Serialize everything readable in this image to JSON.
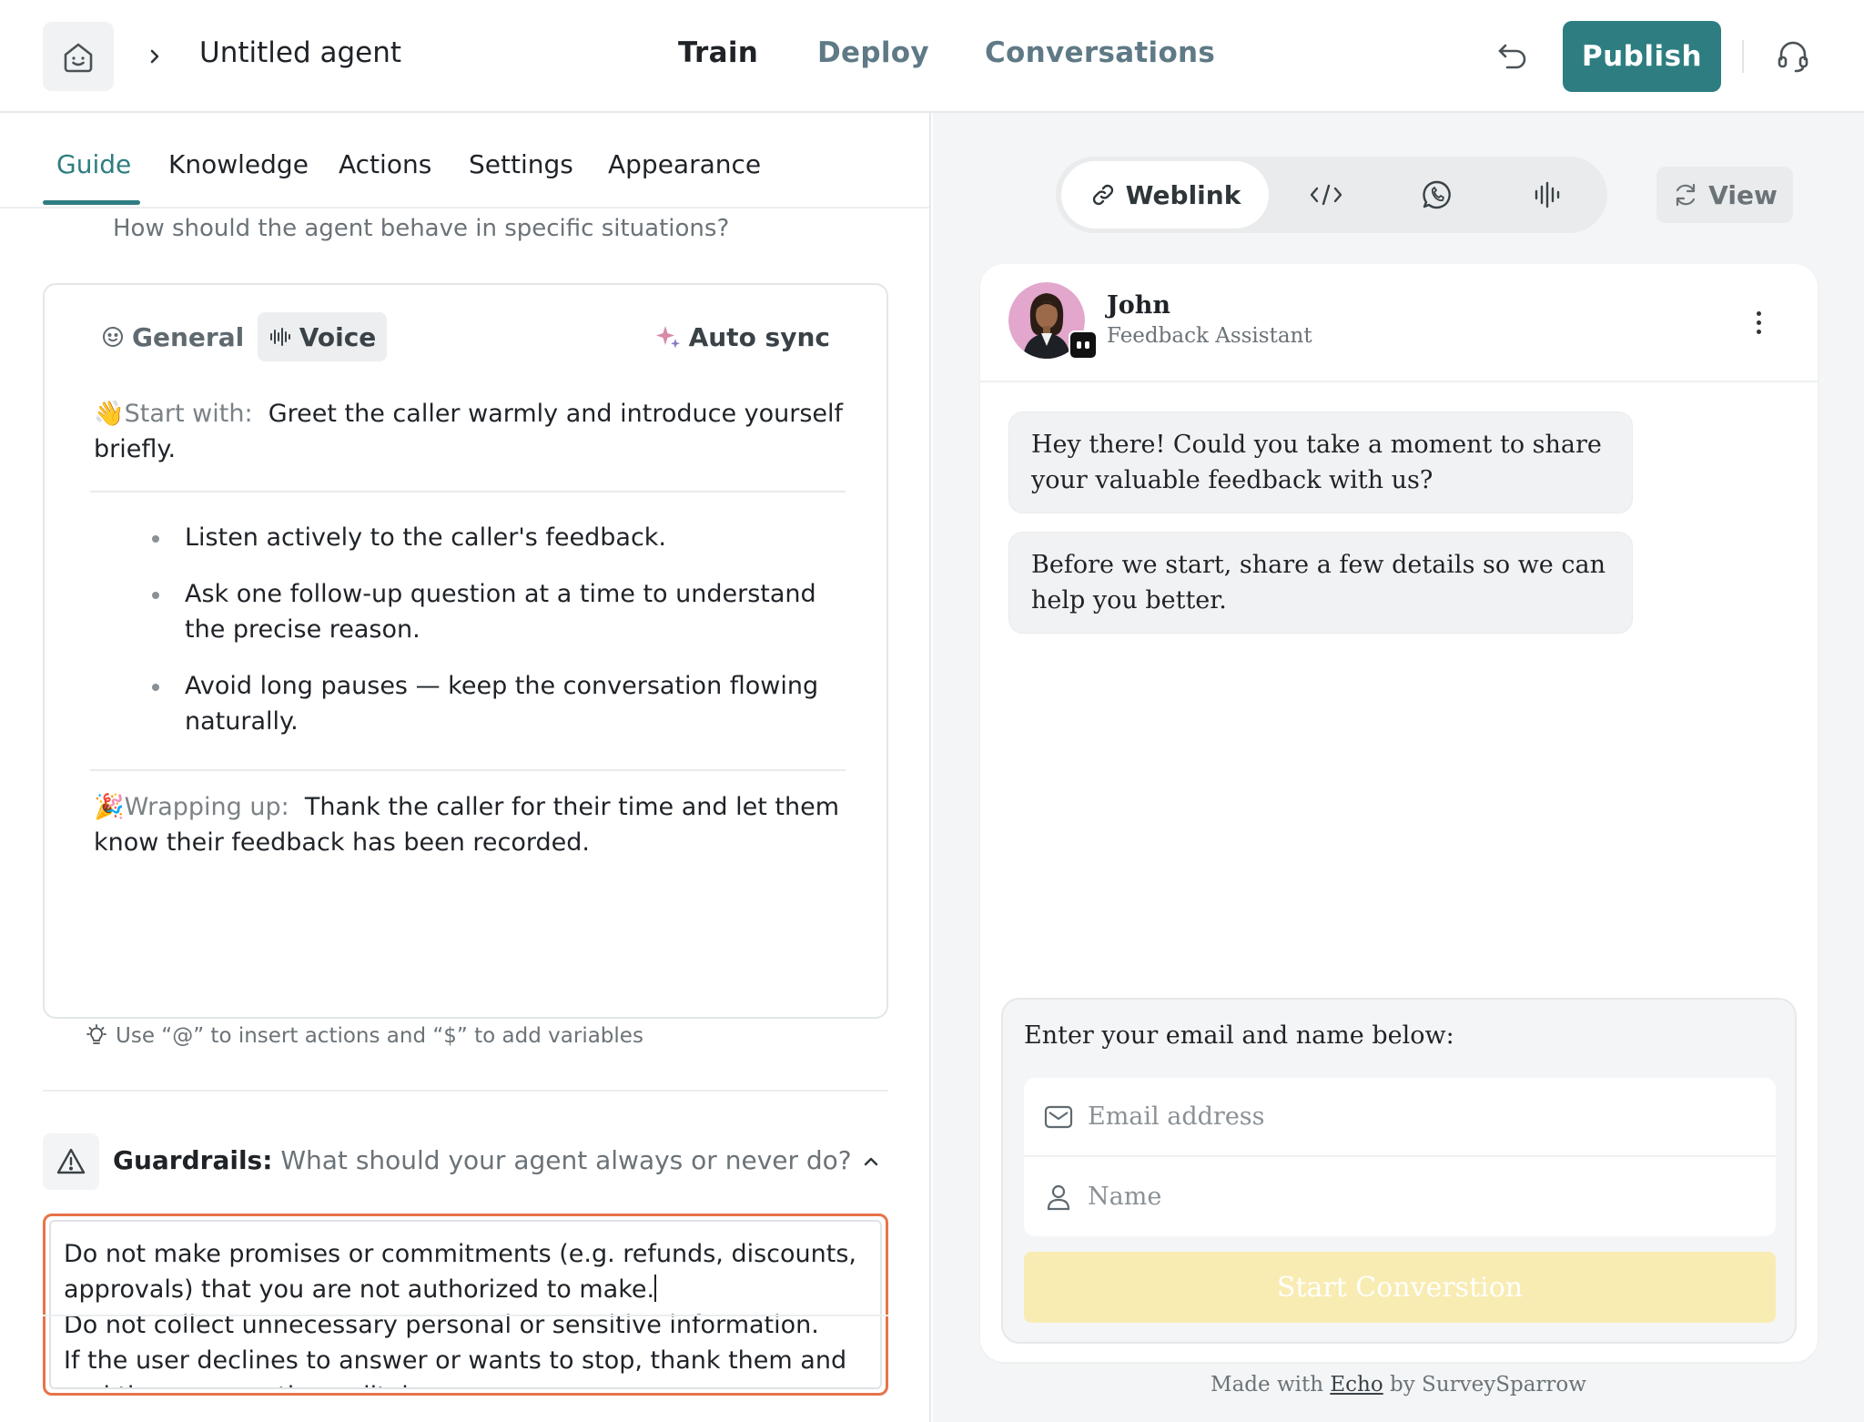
{
  "header": {
    "agent_name": "Untitled agent",
    "nav": [
      "Train",
      "Deploy",
      "Conversations"
    ],
    "active_nav": "Train",
    "publish_label": "Publish",
    "accent": "#2e7d81"
  },
  "left": {
    "tabs": [
      "Guide",
      "Knowledge",
      "Actions",
      "Settings",
      "Appearance"
    ],
    "active_tab": "Guide",
    "situations_hint": "How should the agent behave in specific situations?",
    "chips": {
      "general": "General",
      "voice": "Voice",
      "auto_sync": "Auto sync"
    },
    "start_lead": "Start with:",
    "start_text": "Greet the caller warmly and introduce yourself briefly.",
    "bullets": [
      "Listen actively to the caller's feedback.",
      "Ask one follow-up question at a time to understand the precise reason.",
      "Avoid long pauses — keep the conversation flowing naturally."
    ],
    "wrap_lead": "Wrapping up:",
    "wrap_text": "Thank the caller for their time and let them know their feedback has been recorded.",
    "tip": "Use “@” to insert actions and “$” to add variables",
    "guardrails_label": "Guardrails:",
    "guardrails_hint": "What should your agent always or never do?",
    "guardrails_text_before_caret": "Do not make promises or commitments (e.g. refunds, discounts, approvals) that you are not authorized to make.",
    "guardrails_text_after_caret": "\nDo not collect unnecessary personal or sensitive information.\nIf the user declines to answer or wants to stop, thank them and end the conversation politely."
  },
  "right": {
    "channels": {
      "weblink": "Weblink"
    },
    "view_label": "View",
    "bot": {
      "name": "John",
      "role": "Feedback Assistant"
    },
    "messages": [
      "Hey there! Could you take a moment to share your valuable feedback with us?",
      "Before we start, share a few details so we can help you better."
    ],
    "form": {
      "title": "Enter your email and name below:",
      "email_placeholder": "Email address",
      "name_placeholder": "Name",
      "start_label": "Start Converstion"
    },
    "footer": {
      "prefix": "Made with",
      "brand": "Echo",
      "suffix": "by SurveySparrow"
    }
  }
}
